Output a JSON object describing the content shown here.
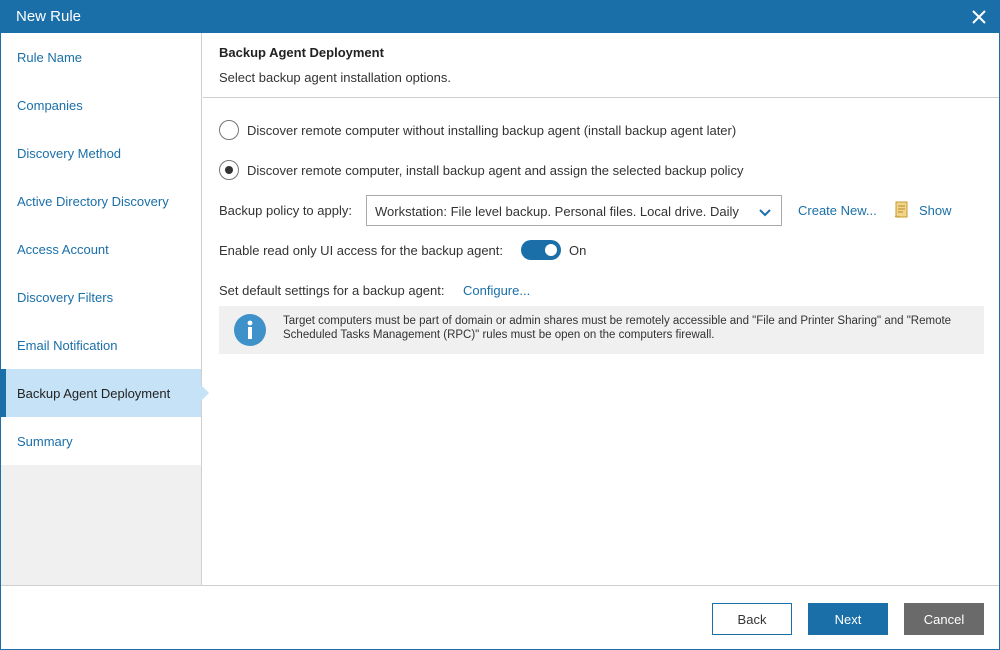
{
  "window": {
    "title": "New Rule"
  },
  "sidebar": {
    "items": [
      {
        "label": "Rule Name"
      },
      {
        "label": "Companies"
      },
      {
        "label": "Discovery Method"
      },
      {
        "label": "Active Directory Discovery"
      },
      {
        "label": "Access Account"
      },
      {
        "label": "Discovery Filters"
      },
      {
        "label": "Email Notification"
      },
      {
        "label": "Backup Agent Deployment",
        "active": true
      },
      {
        "label": "Summary"
      }
    ]
  },
  "header": {
    "title": "Backup Agent Deployment",
    "subtitle": "Select backup agent installation options."
  },
  "options": {
    "radio1_label": "Discover remote computer without installing backup agent (install backup agent later)",
    "radio2_label": "Discover remote computer, install backup agent and assign the selected backup policy",
    "selected": "radio2"
  },
  "policy": {
    "label": "Backup policy to apply:",
    "value": "Workstation: File level backup. Personal files. Local drive. Daily",
    "create_new_label": "Create New...",
    "show_label": "Show"
  },
  "readonly_ui": {
    "label": "Enable read only UI access for the backup agent:",
    "state_label": "On",
    "enabled": true
  },
  "defaults": {
    "label": "Set default settings for a backup agent:",
    "configure_label": "Configure..."
  },
  "info": {
    "text": "Target computers must be part of domain or admin shares must be remotely accessible and \"File and Printer Sharing\" and \"Remote Scheduled Tasks Management (RPC)\" rules must be open on the computers firewall."
  },
  "footer": {
    "back_label": "Back",
    "next_label": "Next",
    "cancel_label": "Cancel"
  },
  "colors": {
    "accent": "#1a6fa8",
    "active_nav_bg": "#c6e2f6",
    "cancel_bg": "#6a6a6a",
    "info_icon": "#3f92c9"
  },
  "icons": {
    "close": "close-icon",
    "dropdown": "chevron-down-icon",
    "show": "document-icon",
    "info": "info-icon"
  }
}
